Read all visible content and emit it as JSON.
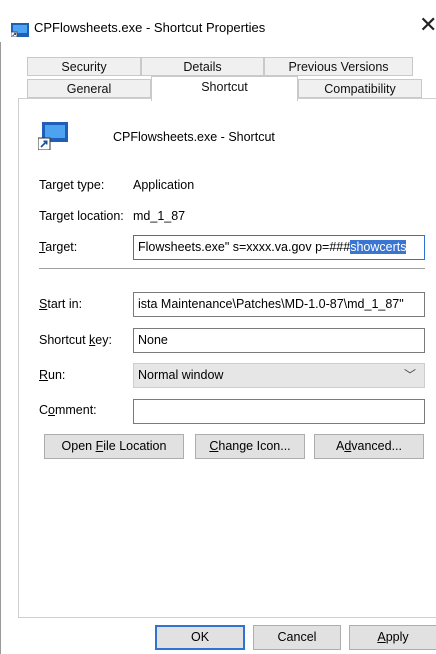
{
  "window": {
    "title": "CPFlowsheets.exe - Shortcut Properties"
  },
  "tabs": {
    "row1": [
      "Security",
      "Details",
      "Previous Versions"
    ],
    "row2": [
      "General",
      "Shortcut",
      "Compatibility"
    ],
    "active": "Shortcut"
  },
  "shortcut": {
    "name": "CPFlowsheets.exe - Shortcut",
    "target_type_label": "Target type:",
    "target_type": "Application",
    "target_location_label": "Target location:",
    "target_location": "md_1_87",
    "target_label": "Target:",
    "target_value_before": "Flowsheets.exe\" s=xxxx.va.gov p=###",
    "target_value_selected": "showcerts",
    "start_in_label": "Start in:",
    "start_in": "ista Maintenance\\Patches\\MD-1.0-87\\md_1_87\"",
    "shortcut_key_label": "Shortcut key:",
    "shortcut_key": "None",
    "run_label": "Run:",
    "run": "Normal window",
    "comment_label": "Comment:",
    "comment": ""
  },
  "buttons": {
    "open_file_location": "Open File Location",
    "change_icon": "Change Icon...",
    "advanced": "Advanced...",
    "ok": "OK",
    "cancel": "Cancel",
    "apply": "Apply"
  }
}
